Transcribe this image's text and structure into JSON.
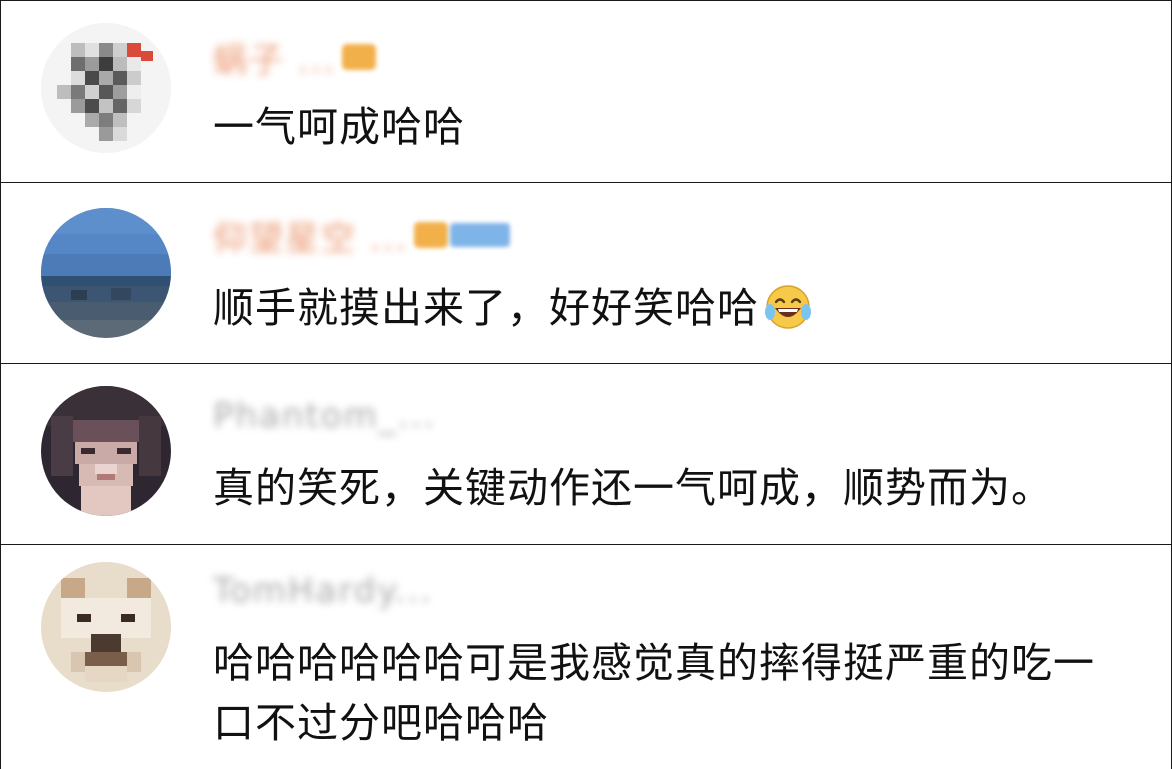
{
  "comments": [
    {
      "username": "蜗子 ...",
      "text": "一气呵成哈哈",
      "badge": "vip-badge-icon"
    },
    {
      "username": "仰望星空 ...",
      "text": "顺手就摸出来了，好好笑哈哈",
      "emoji": "laughing-tears-emoji",
      "badge": "vip-level-badge-icon"
    },
    {
      "username": "Phantom_...",
      "text": "真的笑死，关键动作还一气呵成，顺势而为。"
    },
    {
      "username": "TomHardy...",
      "text": "哈哈哈哈哈哈可是我感觉真的摔得挺严重的吃一口不过分吧哈哈哈"
    }
  ],
  "colors": {
    "username_vip": "#e8875a",
    "username_plain": "#9a9a9a",
    "divider": "#1a1a1a",
    "text": "#111111"
  }
}
